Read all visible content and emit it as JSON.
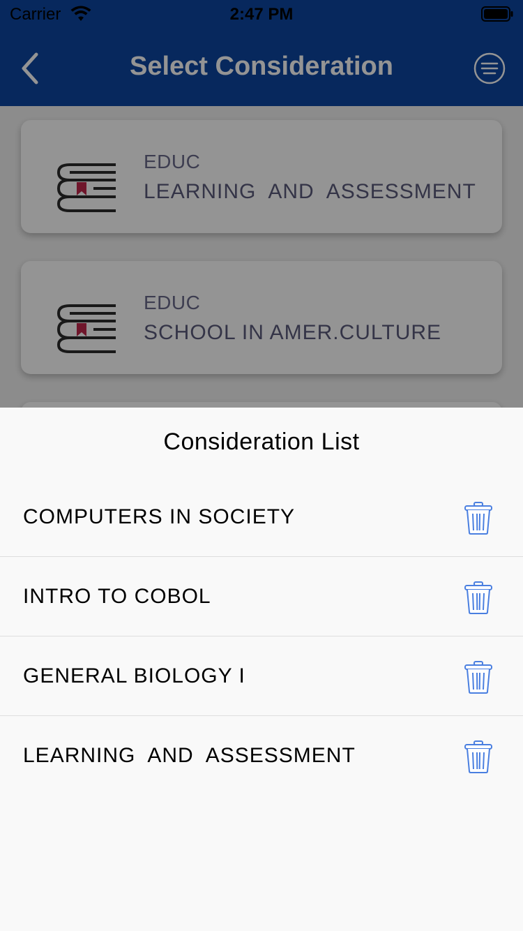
{
  "status_bar": {
    "carrier": "Carrier",
    "time": "2:47 PM",
    "wifi_icon": "wifi-icon",
    "battery_icon": "battery-icon"
  },
  "nav": {
    "title": "Select Consideration",
    "back_icon": "chevron-left-icon",
    "menu_icon": "list-circle-icon"
  },
  "courses": [
    {
      "dept": "EDUC",
      "name": "LEARNING  AND  ASSESSMENT",
      "icon": "book-stack-icon"
    },
    {
      "dept": "EDUC",
      "name": "SCHOOL IN AMER.CULTURE",
      "icon": "book-stack-icon"
    }
  ],
  "sheet": {
    "title": "Consideration List",
    "items": [
      {
        "label": "COMPUTERS IN SOCIETY",
        "icon": "trash-icon"
      },
      {
        "label": "INTRO TO COBOL",
        "icon": "trash-icon"
      },
      {
        "label": "GENERAL BIOLOGY I",
        "icon": "trash-icon"
      },
      {
        "label": "LEARNING  AND  ASSESSMENT",
        "icon": "trash-icon"
      }
    ]
  },
  "colors": {
    "nav_background": "#0d46a0",
    "trash_icon": "#4a7fe0",
    "book_bookmark": "#c0264a"
  }
}
